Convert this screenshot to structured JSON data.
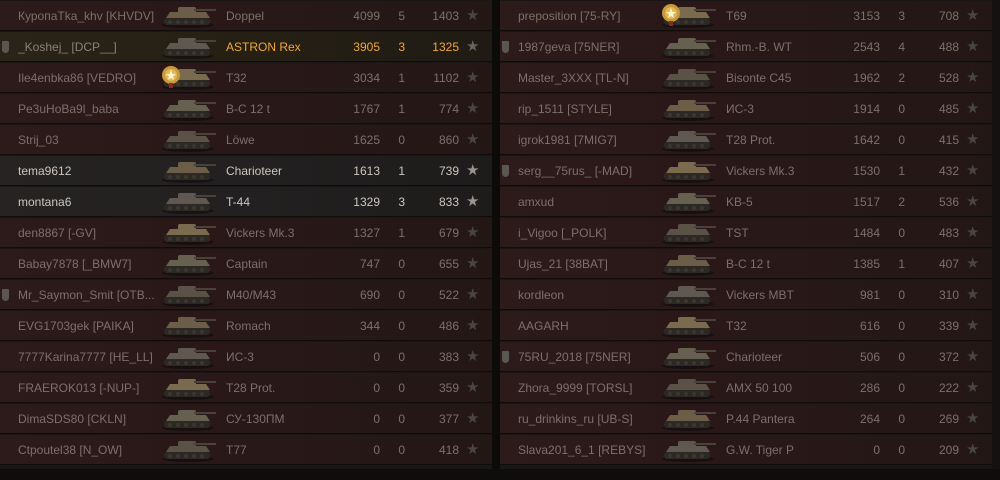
{
  "teams": {
    "left": [
      {
        "name": "КуропаTka_khv [KHVDV]",
        "tank": "Doppel",
        "damage": "4099",
        "frags": "5",
        "xp": "1403",
        "state": "killed"
      },
      {
        "name": "_Koshej_ [DCP__]",
        "tank": "ASTRON Rex",
        "damage": "3905",
        "frags": "3",
        "xp": "1325",
        "state": "player",
        "badge": true
      },
      {
        "name": "Ile4enbka86 [VEDRO]",
        "tank": "T32",
        "damage": "3034",
        "frags": "1",
        "xp": "1102",
        "state": "killed",
        "medal": true
      },
      {
        "name": "Pe3uHoBa9l_baba",
        "tank": "B-C 12 t",
        "damage": "1767",
        "frags": "1",
        "xp": "774",
        "state": "killed"
      },
      {
        "name": "Strij_03",
        "tank": "Löwe",
        "damage": "1625",
        "frags": "0",
        "xp": "860",
        "state": "killed"
      },
      {
        "name": "tema9612",
        "tank": "Charioteer",
        "damage": "1613",
        "frags": "1",
        "xp": "739",
        "state": "alive"
      },
      {
        "name": "montana6",
        "tank": "T-44",
        "damage": "1329",
        "frags": "3",
        "xp": "833",
        "state": "alive"
      },
      {
        "name": "den8867 [-GV]",
        "tank": "Vickers Mk.3",
        "damage": "1327",
        "frags": "1",
        "xp": "679",
        "state": "killed"
      },
      {
        "name": "Babay7878 [_BMW7]",
        "tank": "Captain",
        "damage": "747",
        "frags": "0",
        "xp": "655",
        "state": "killed"
      },
      {
        "name": "Mr_Saymon_Smit [OTB...",
        "tank": "M40/M43",
        "damage": "690",
        "frags": "0",
        "xp": "522",
        "state": "killed",
        "badge": true
      },
      {
        "name": "EVG1703gek [PAIKA]",
        "tank": "Romach",
        "damage": "344",
        "frags": "0",
        "xp": "486",
        "state": "killed"
      },
      {
        "name": "7777Karina7777 [HE_LL]",
        "tank": "ИС-3",
        "damage": "0",
        "frags": "0",
        "xp": "383",
        "state": "killed"
      },
      {
        "name": "FRAEROK013 [-NUP-]",
        "tank": "T28 Prot.",
        "damage": "0",
        "frags": "0",
        "xp": "359",
        "state": "killed"
      },
      {
        "name": "DimaSDS80 [CKLN]",
        "tank": "СУ-130ПМ",
        "damage": "0",
        "frags": "0",
        "xp": "377",
        "state": "killed"
      },
      {
        "name": "Ctpoutel38 [N_OW]",
        "tank": "T77",
        "damage": "0",
        "frags": "0",
        "xp": "418",
        "state": "killed"
      }
    ],
    "right": [
      {
        "name": "preposition [75-RY]",
        "tank": "T69",
        "damage": "3153",
        "frags": "3",
        "xp": "708",
        "state": "killed",
        "medal": true
      },
      {
        "name": "1987geva [75NER]",
        "tank": "Rhm.-B. WT",
        "damage": "2543",
        "frags": "4",
        "xp": "488",
        "state": "killed",
        "badge": true
      },
      {
        "name": "Master_3XXX [TL-N]",
        "tank": "Bisonte C45",
        "damage": "1962",
        "frags": "2",
        "xp": "528",
        "state": "killed"
      },
      {
        "name": "rip_1511 [STYLE]",
        "tank": "ИС-3",
        "damage": "1914",
        "frags": "0",
        "xp": "485",
        "state": "killed"
      },
      {
        "name": "igrok1981 [7MIG7]",
        "tank": "T28 Prot.",
        "damage": "1642",
        "frags": "0",
        "xp": "415",
        "state": "killed"
      },
      {
        "name": "serg__75rus_ [-MAD]",
        "tank": "Vickers Mk.3",
        "damage": "1530",
        "frags": "1",
        "xp": "432",
        "state": "killed",
        "badge": true
      },
      {
        "name": "amxud",
        "tank": "KB-5",
        "damage": "1517",
        "frags": "2",
        "xp": "536",
        "state": "killed"
      },
      {
        "name": "i_Vigoo [_POLK]",
        "tank": "TST",
        "damage": "1484",
        "frags": "0",
        "xp": "483",
        "state": "killed"
      },
      {
        "name": "Ujas_21 [38BAT]",
        "tank": "B-C 12 t",
        "damage": "1385",
        "frags": "1",
        "xp": "407",
        "state": "killed"
      },
      {
        "name": "kordleon",
        "tank": "Vickers MBT",
        "damage": "981",
        "frags": "0",
        "xp": "310",
        "state": "killed"
      },
      {
        "name": "AAGARH",
        "tank": "T32",
        "damage": "616",
        "frags": "0",
        "xp": "339",
        "state": "killed"
      },
      {
        "name": "75RU_2018 [75NER]",
        "tank": "Charioteer",
        "damage": "506",
        "frags": "0",
        "xp": "372",
        "state": "killed",
        "badge": true
      },
      {
        "name": "Zhora_9999 [TORSL]",
        "tank": "AMX 50 100",
        "damage": "286",
        "frags": "0",
        "xp": "222",
        "state": "killed"
      },
      {
        "name": "ru_drinkins_ru [UB-S]",
        "tank": "P.44 Pantera",
        "damage": "264",
        "frags": "0",
        "xp": "269",
        "state": "killed"
      },
      {
        "name": "Slava201_6_1 [REBYS]",
        "tank": "G.W. Tiger P",
        "damage": "0",
        "frags": "0",
        "xp": "209",
        "state": "killed"
      }
    ]
  },
  "icons": {
    "row_mark": "star-icon",
    "vehicle": "tank-icon",
    "achievement": "mastery-medal-icon",
    "rank": "rank-badge-icon"
  },
  "colors": {
    "player_highlight": "#f0a63a",
    "alive_text": "#cdc6c0",
    "dead_text": "#8a807a"
  }
}
